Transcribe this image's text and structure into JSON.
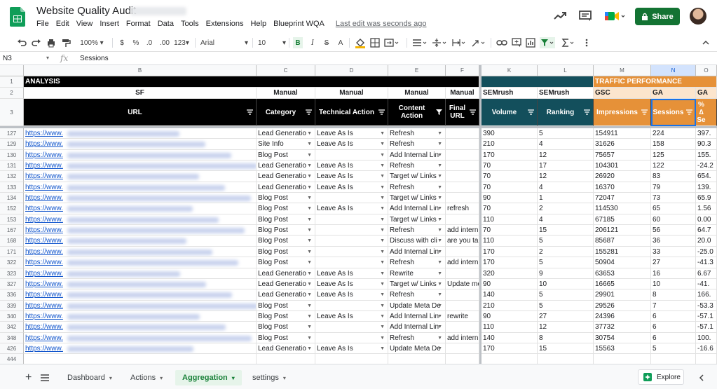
{
  "header": {
    "title": "Website Quality Audit",
    "menu": [
      "File",
      "Edit",
      "View",
      "Insert",
      "Format",
      "Data",
      "Tools",
      "Extensions",
      "Help",
      "Blueprint WQA"
    ],
    "last_edit": "Last edit was seconds ago",
    "share_label": "Share"
  },
  "toolbar": {
    "zoom": "100%",
    "currency": "$",
    "percent": "%",
    "dec_dec": ".0",
    "dec_inc": ".00",
    "more_formats": "123",
    "font": "Arial",
    "font_size": "10"
  },
  "formula_bar": {
    "name_box": "N3",
    "fx": "fx",
    "content": "Sessions"
  },
  "grid": {
    "columns": [
      "B",
      "C",
      "D",
      "E",
      "F",
      "K",
      "L",
      "M",
      "N",
      "O"
    ],
    "section_row": {
      "analysis": "ANALYSIS",
      "traffic": "TRAFFIC PERFORMANCE"
    },
    "source_row": [
      "SF",
      "Manual",
      "Manual",
      "Manual",
      "Manual",
      "SEMrush",
      "SEMrush",
      "GSC",
      "GA",
      "GA"
    ],
    "header_row": [
      "URL",
      "Category",
      "Technical Action",
      "Content Action",
      "Final URL",
      "Volume",
      "Ranking",
      "Impressions",
      "Sessions",
      "% ∆ Se"
    ],
    "rows": [
      {
        "n": "127",
        "url": "https://www.",
        "cat": "Lead Generatio",
        "tech": "Leave As Is",
        "content": "Refresh",
        "final": "",
        "vol": "390",
        "rank": "5",
        "imp": "154911",
        "sess": "224",
        "pct": "397."
      },
      {
        "n": "129",
        "url": "https://www.",
        "cat": "Site Info",
        "tech": "Leave As Is",
        "content": "Refresh",
        "final": "",
        "vol": "210",
        "rank": "4",
        "imp": "31626",
        "sess": "158",
        "pct": "90.3"
      },
      {
        "n": "130",
        "url": "https://www.",
        "cat": "Blog Post",
        "tech": "",
        "content": "Add Internal Lin",
        "final": "",
        "vol": "170",
        "rank": "12",
        "imp": "75657",
        "sess": "125",
        "pct": "155."
      },
      {
        "n": "131",
        "url": "https://www.",
        "cat": "Lead Generatio",
        "tech": "Leave As Is",
        "content": "Refresh",
        "final": "",
        "vol": "70",
        "rank": "17",
        "imp": "104301",
        "sess": "122",
        "pct": "-24.2"
      },
      {
        "n": "132",
        "url": "https://www.",
        "cat": "Lead Generatio",
        "tech": "Leave As Is",
        "content": "Target w/ Links",
        "final": "",
        "vol": "70",
        "rank": "12",
        "imp": "26920",
        "sess": "83",
        "pct": "654."
      },
      {
        "n": "133",
        "url": "https://www.",
        "cat": "Lead Generatio",
        "tech": "Leave As Is",
        "content": "Refresh",
        "final": "",
        "vol": "70",
        "rank": "4",
        "imp": "16370",
        "sess": "79",
        "pct": "139."
      },
      {
        "n": "134",
        "url": "https://www.",
        "cat": "Blog Post",
        "tech": "",
        "content": "Target w/ Links",
        "final": "",
        "vol": "90",
        "rank": "1",
        "imp": "72047",
        "sess": "73",
        "pct": "65.9"
      },
      {
        "n": "152",
        "url": "https://www.",
        "cat": "Blog Post",
        "tech": "Leave As Is",
        "content": "Add Internal Lin",
        "final": "refresh",
        "vol": "70",
        "rank": "2",
        "imp": "114530",
        "sess": "65",
        "pct": "1.56"
      },
      {
        "n": "153",
        "url": "https://www.",
        "cat": "Blog Post",
        "tech": "",
        "content": "Target w/ Links",
        "final": "",
        "vol": "110",
        "rank": "4",
        "imp": "67185",
        "sess": "60",
        "pct": "0.00"
      },
      {
        "n": "167",
        "url": "https://www.",
        "cat": "Blog Post",
        "tech": "",
        "content": "Refresh",
        "final": "add intern",
        "vol": "70",
        "rank": "15",
        "imp": "206121",
        "sess": "56",
        "pct": "64.7"
      },
      {
        "n": "168",
        "url": "https://www.",
        "cat": "Blog Post",
        "tech": "",
        "content": "Discuss with cli",
        "final": "are you ta",
        "vol": "110",
        "rank": "5",
        "imp": "85687",
        "sess": "36",
        "pct": "20.0"
      },
      {
        "n": "171",
        "url": "https://www.",
        "cat": "Blog Post",
        "tech": "",
        "content": "Add Internal Lin",
        "final": "",
        "vol": "170",
        "rank": "2",
        "imp": "155281",
        "sess": "33",
        "pct": "-25.0"
      },
      {
        "n": "322",
        "url": "https://www.",
        "cat": "Blog Post",
        "tech": "",
        "content": "Refresh",
        "final": "add intern",
        "vol": "170",
        "rank": "5",
        "imp": "50904",
        "sess": "27",
        "pct": "-41.3"
      },
      {
        "n": "323",
        "url": "https://www.",
        "cat": "Lead Generatio",
        "tech": "Leave As Is",
        "content": "Rewrite",
        "final": "",
        "vol": "320",
        "rank": "9",
        "imp": "63653",
        "sess": "16",
        "pct": "6.67"
      },
      {
        "n": "327",
        "url": "https://www.",
        "cat": "Lead Generatio",
        "tech": "Leave As Is",
        "content": "Target w/ Links",
        "final": "Update me",
        "vol": "90",
        "rank": "10",
        "imp": "16665",
        "sess": "10",
        "pct": "-41."
      },
      {
        "n": "336",
        "url": "https://www.",
        "cat": "Lead Generatio",
        "tech": "Leave As Is",
        "content": "Refresh",
        "final": "",
        "vol": "140",
        "rank": "5",
        "imp": "29901",
        "sess": "8",
        "pct": "166."
      },
      {
        "n": "339",
        "url": "https://www.",
        "cat": "Blog Post",
        "tech": "",
        "content": "Update Meta De",
        "final": "",
        "vol": "210",
        "rank": "5",
        "imp": "29526",
        "sess": "7",
        "pct": "-53.3"
      },
      {
        "n": "340",
        "url": "https://www.",
        "cat": "Blog Post",
        "tech": "Leave As Is",
        "content": "Add Internal Lin",
        "final": "rewrite",
        "vol": "90",
        "rank": "27",
        "imp": "24396",
        "sess": "6",
        "pct": "-57.1"
      },
      {
        "n": "342",
        "url": "https://www.",
        "cat": "Blog Post",
        "tech": "",
        "content": "Add Internal Lin",
        "final": "",
        "vol": "110",
        "rank": "12",
        "imp": "37732",
        "sess": "6",
        "pct": "-57.1"
      },
      {
        "n": "348",
        "url": "https://www.",
        "cat": "Blog Post",
        "tech": "",
        "content": "Refresh",
        "final": "add intern",
        "vol": "140",
        "rank": "8",
        "imp": "30754",
        "sess": "6",
        "pct": "100."
      },
      {
        "n": "426",
        "url": "https://www.",
        "cat": "Lead Generatio",
        "tech": "Leave As Is",
        "content": "Update Meta De",
        "final": "",
        "vol": "170",
        "rank": "15",
        "imp": "15563",
        "sess": "5",
        "pct": "-16.6"
      },
      {
        "n": "444",
        "url": "",
        "cat": "",
        "tech": "",
        "content": "",
        "final": "",
        "vol": "",
        "rank": "",
        "imp": "",
        "sess": "",
        "pct": ""
      }
    ]
  },
  "tabs": {
    "sheets": [
      "Dashboard",
      "Actions",
      "Aggregation",
      "settings"
    ],
    "active": "Aggregation",
    "explore": "Explore"
  },
  "colors": {
    "section_black": "#000000",
    "traffic_orange": "#e69138",
    "teal_header": "#134f5c",
    "accent_green": "#137333"
  }
}
